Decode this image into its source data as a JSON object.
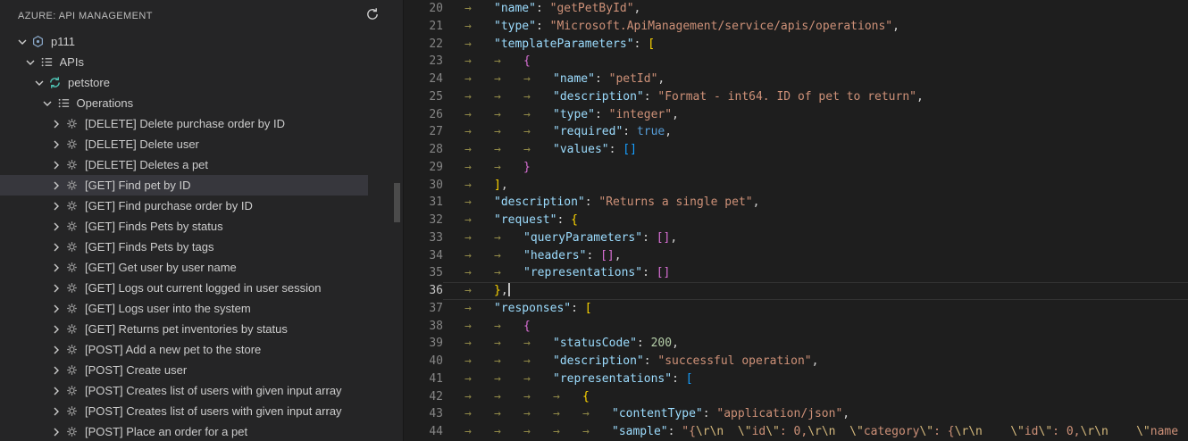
{
  "sidebar": {
    "title": "AZURE: API MANAGEMENT",
    "refresh_icon": "refresh",
    "tree": [
      {
        "label": "p111",
        "level": 0,
        "expanded": true,
        "icon": "service",
        "selected": false
      },
      {
        "label": "APIs",
        "level": 1,
        "expanded": true,
        "icon": "list",
        "selected": false
      },
      {
        "label": "petstore",
        "level": 2,
        "expanded": true,
        "icon": "api",
        "selected": false
      },
      {
        "label": "Operations",
        "level": 3,
        "expanded": true,
        "icon": "list",
        "selected": false
      },
      {
        "label": "[DELETE] Delete purchase order by ID",
        "level": 4,
        "expanded": false,
        "icon": "operation",
        "selected": false
      },
      {
        "label": "[DELETE] Delete user",
        "level": 4,
        "expanded": false,
        "icon": "operation",
        "selected": false
      },
      {
        "label": "[DELETE] Deletes a pet",
        "level": 4,
        "expanded": false,
        "icon": "operation",
        "selected": false
      },
      {
        "label": "[GET] Find pet by ID",
        "level": 4,
        "expanded": false,
        "icon": "operation",
        "selected": true
      },
      {
        "label": "[GET] Find purchase order by ID",
        "level": 4,
        "expanded": false,
        "icon": "operation",
        "selected": false
      },
      {
        "label": "[GET] Finds Pets by status",
        "level": 4,
        "expanded": false,
        "icon": "operation",
        "selected": false
      },
      {
        "label": "[GET] Finds Pets by tags",
        "level": 4,
        "expanded": false,
        "icon": "operation",
        "selected": false
      },
      {
        "label": "[GET] Get user by user name",
        "level": 4,
        "expanded": false,
        "icon": "operation",
        "selected": false
      },
      {
        "label": "[GET] Logs out current logged in user session",
        "level": 4,
        "expanded": false,
        "icon": "operation",
        "selected": false
      },
      {
        "label": "[GET] Logs user into the system",
        "level": 4,
        "expanded": false,
        "icon": "operation",
        "selected": false
      },
      {
        "label": "[GET] Returns pet inventories by status",
        "level": 4,
        "expanded": false,
        "icon": "operation",
        "selected": false
      },
      {
        "label": "[POST] Add a new pet to the store",
        "level": 4,
        "expanded": false,
        "icon": "operation",
        "selected": false
      },
      {
        "label": "[POST] Create user",
        "level": 4,
        "expanded": false,
        "icon": "operation",
        "selected": false
      },
      {
        "label": "[POST] Creates list of users with given input array",
        "level": 4,
        "expanded": false,
        "icon": "operation",
        "selected": false
      },
      {
        "label": "[POST] Creates list of users with given input array",
        "level": 4,
        "expanded": false,
        "icon": "operation",
        "selected": false
      },
      {
        "label": "[POST] Place an order for a pet",
        "level": 4,
        "expanded": false,
        "icon": "operation",
        "selected": false
      }
    ]
  },
  "editor": {
    "current_line": 36,
    "lines": [
      {
        "num": 20,
        "tabs": 1,
        "tokens": [
          [
            "key",
            "\"name\""
          ],
          [
            "pun",
            ": "
          ],
          [
            "str",
            "\"getPetById\""
          ],
          [
            "pun",
            ","
          ]
        ]
      },
      {
        "num": 21,
        "tabs": 1,
        "tokens": [
          [
            "key",
            "\"type\""
          ],
          [
            "pun",
            ": "
          ],
          [
            "str",
            "\"Microsoft.ApiManagement/service/apis/operations\""
          ],
          [
            "pun",
            ","
          ]
        ]
      },
      {
        "num": 22,
        "tabs": 1,
        "tokens": [
          [
            "key",
            "\"templateParameters\""
          ],
          [
            "pun",
            ": "
          ],
          [
            "b1",
            "["
          ]
        ]
      },
      {
        "num": 23,
        "tabs": 2,
        "tokens": [
          [
            "b2",
            "{"
          ]
        ]
      },
      {
        "num": 24,
        "tabs": 3,
        "tokens": [
          [
            "key",
            "\"name\""
          ],
          [
            "pun",
            ": "
          ],
          [
            "str",
            "\"petId\""
          ],
          [
            "pun",
            ","
          ]
        ]
      },
      {
        "num": 25,
        "tabs": 3,
        "tokens": [
          [
            "key",
            "\"description\""
          ],
          [
            "pun",
            ": "
          ],
          [
            "str",
            "\"Format - int64. ID of pet to return\""
          ],
          [
            "pun",
            ","
          ]
        ]
      },
      {
        "num": 26,
        "tabs": 3,
        "tokens": [
          [
            "key",
            "\"type\""
          ],
          [
            "pun",
            ": "
          ],
          [
            "str",
            "\"integer\""
          ],
          [
            "pun",
            ","
          ]
        ]
      },
      {
        "num": 27,
        "tabs": 3,
        "tokens": [
          [
            "key",
            "\"required\""
          ],
          [
            "pun",
            ": "
          ],
          [
            "kw",
            "true"
          ],
          [
            "pun",
            ","
          ]
        ]
      },
      {
        "num": 28,
        "tabs": 3,
        "tokens": [
          [
            "key",
            "\"values\""
          ],
          [
            "pun",
            ": "
          ],
          [
            "b3",
            "[]"
          ]
        ]
      },
      {
        "num": 29,
        "tabs": 2,
        "tokens": [
          [
            "b2",
            "}"
          ]
        ]
      },
      {
        "num": 30,
        "tabs": 1,
        "tokens": [
          [
            "b1",
            "]"
          ],
          [
            "pun",
            ","
          ]
        ]
      },
      {
        "num": 31,
        "tabs": 1,
        "tokens": [
          [
            "key",
            "\"description\""
          ],
          [
            "pun",
            ": "
          ],
          [
            "str",
            "\"Returns a single pet\""
          ],
          [
            "pun",
            ","
          ]
        ]
      },
      {
        "num": 32,
        "tabs": 1,
        "tokens": [
          [
            "key",
            "\"request\""
          ],
          [
            "pun",
            ": "
          ],
          [
            "b1",
            "{"
          ]
        ]
      },
      {
        "num": 33,
        "tabs": 2,
        "tokens": [
          [
            "key",
            "\"queryParameters\""
          ],
          [
            "pun",
            ": "
          ],
          [
            "b2",
            "[]"
          ],
          [
            "pun",
            ","
          ]
        ]
      },
      {
        "num": 34,
        "tabs": 2,
        "tokens": [
          [
            "key",
            "\"headers\""
          ],
          [
            "pun",
            ": "
          ],
          [
            "b2",
            "[]"
          ],
          [
            "pun",
            ","
          ]
        ]
      },
      {
        "num": 35,
        "tabs": 2,
        "tokens": [
          [
            "key",
            "\"representations\""
          ],
          [
            "pun",
            ": "
          ],
          [
            "b2",
            "[]"
          ]
        ]
      },
      {
        "num": 36,
        "tabs": 1,
        "cursor": true,
        "tokens": [
          [
            "b1",
            "}"
          ],
          [
            "pun",
            ","
          ]
        ]
      },
      {
        "num": 37,
        "tabs": 1,
        "tokens": [
          [
            "key",
            "\"responses\""
          ],
          [
            "pun",
            ": "
          ],
          [
            "b1",
            "["
          ]
        ]
      },
      {
        "num": 38,
        "tabs": 2,
        "tokens": [
          [
            "b2",
            "{"
          ]
        ]
      },
      {
        "num": 39,
        "tabs": 3,
        "tokens": [
          [
            "key",
            "\"statusCode\""
          ],
          [
            "pun",
            ": "
          ],
          [
            "num",
            "200"
          ],
          [
            "pun",
            ","
          ]
        ]
      },
      {
        "num": 40,
        "tabs": 3,
        "tokens": [
          [
            "key",
            "\"description\""
          ],
          [
            "pun",
            ": "
          ],
          [
            "str",
            "\"successful operation\""
          ],
          [
            "pun",
            ","
          ]
        ]
      },
      {
        "num": 41,
        "tabs": 3,
        "tokens": [
          [
            "key",
            "\"representations\""
          ],
          [
            "pun",
            ": "
          ],
          [
            "b3",
            "["
          ]
        ]
      },
      {
        "num": 42,
        "tabs": 4,
        "tokens": [
          [
            "b1",
            "{"
          ]
        ]
      },
      {
        "num": 43,
        "tabs": 5,
        "tokens": [
          [
            "key",
            "\"contentType\""
          ],
          [
            "pun",
            ": "
          ],
          [
            "str",
            "\"application/json\""
          ],
          [
            "pun",
            ","
          ]
        ]
      },
      {
        "num": 44,
        "tabs": 5,
        "tokens": [
          [
            "key",
            "\"sample\""
          ],
          [
            "pun",
            ": "
          ],
          [
            "str",
            "\"{"
          ],
          [
            "esc",
            "\\r\\n"
          ],
          [
            "str",
            "  "
          ],
          [
            "esc",
            "\\\""
          ],
          [
            "str",
            "id"
          ],
          [
            "esc",
            "\\\""
          ],
          [
            "str",
            ": 0,"
          ],
          [
            "esc",
            "\\r\\n"
          ],
          [
            "str",
            "  "
          ],
          [
            "esc",
            "\\\""
          ],
          [
            "str",
            "category"
          ],
          [
            "esc",
            "\\\""
          ],
          [
            "str",
            ": {"
          ],
          [
            "esc",
            "\\r\\n"
          ],
          [
            "str",
            "    "
          ],
          [
            "esc",
            "\\\""
          ],
          [
            "str",
            "id"
          ],
          [
            "esc",
            "\\\""
          ],
          [
            "str",
            ": 0,"
          ],
          [
            "esc",
            "\\r\\n"
          ],
          [
            "str",
            "    "
          ],
          [
            "esc",
            "\\\""
          ],
          [
            "str",
            "name"
          ]
        ]
      }
    ]
  },
  "palette": {
    "sidebar_bg": "#252526",
    "editor_bg": "#1e1e1e",
    "selected_row_bg": "#37373d",
    "key_color": "#9cdcfe",
    "string_color": "#ce9178",
    "escape_color": "#d7ba7d",
    "number_color": "#b5cea8",
    "keyword_color": "#569cd6",
    "bracket_colors": [
      "#ffd700",
      "#da70d6",
      "#179fff"
    ],
    "whitespace_arrow_color": "#9d944c",
    "line_number_color": "#858585"
  }
}
